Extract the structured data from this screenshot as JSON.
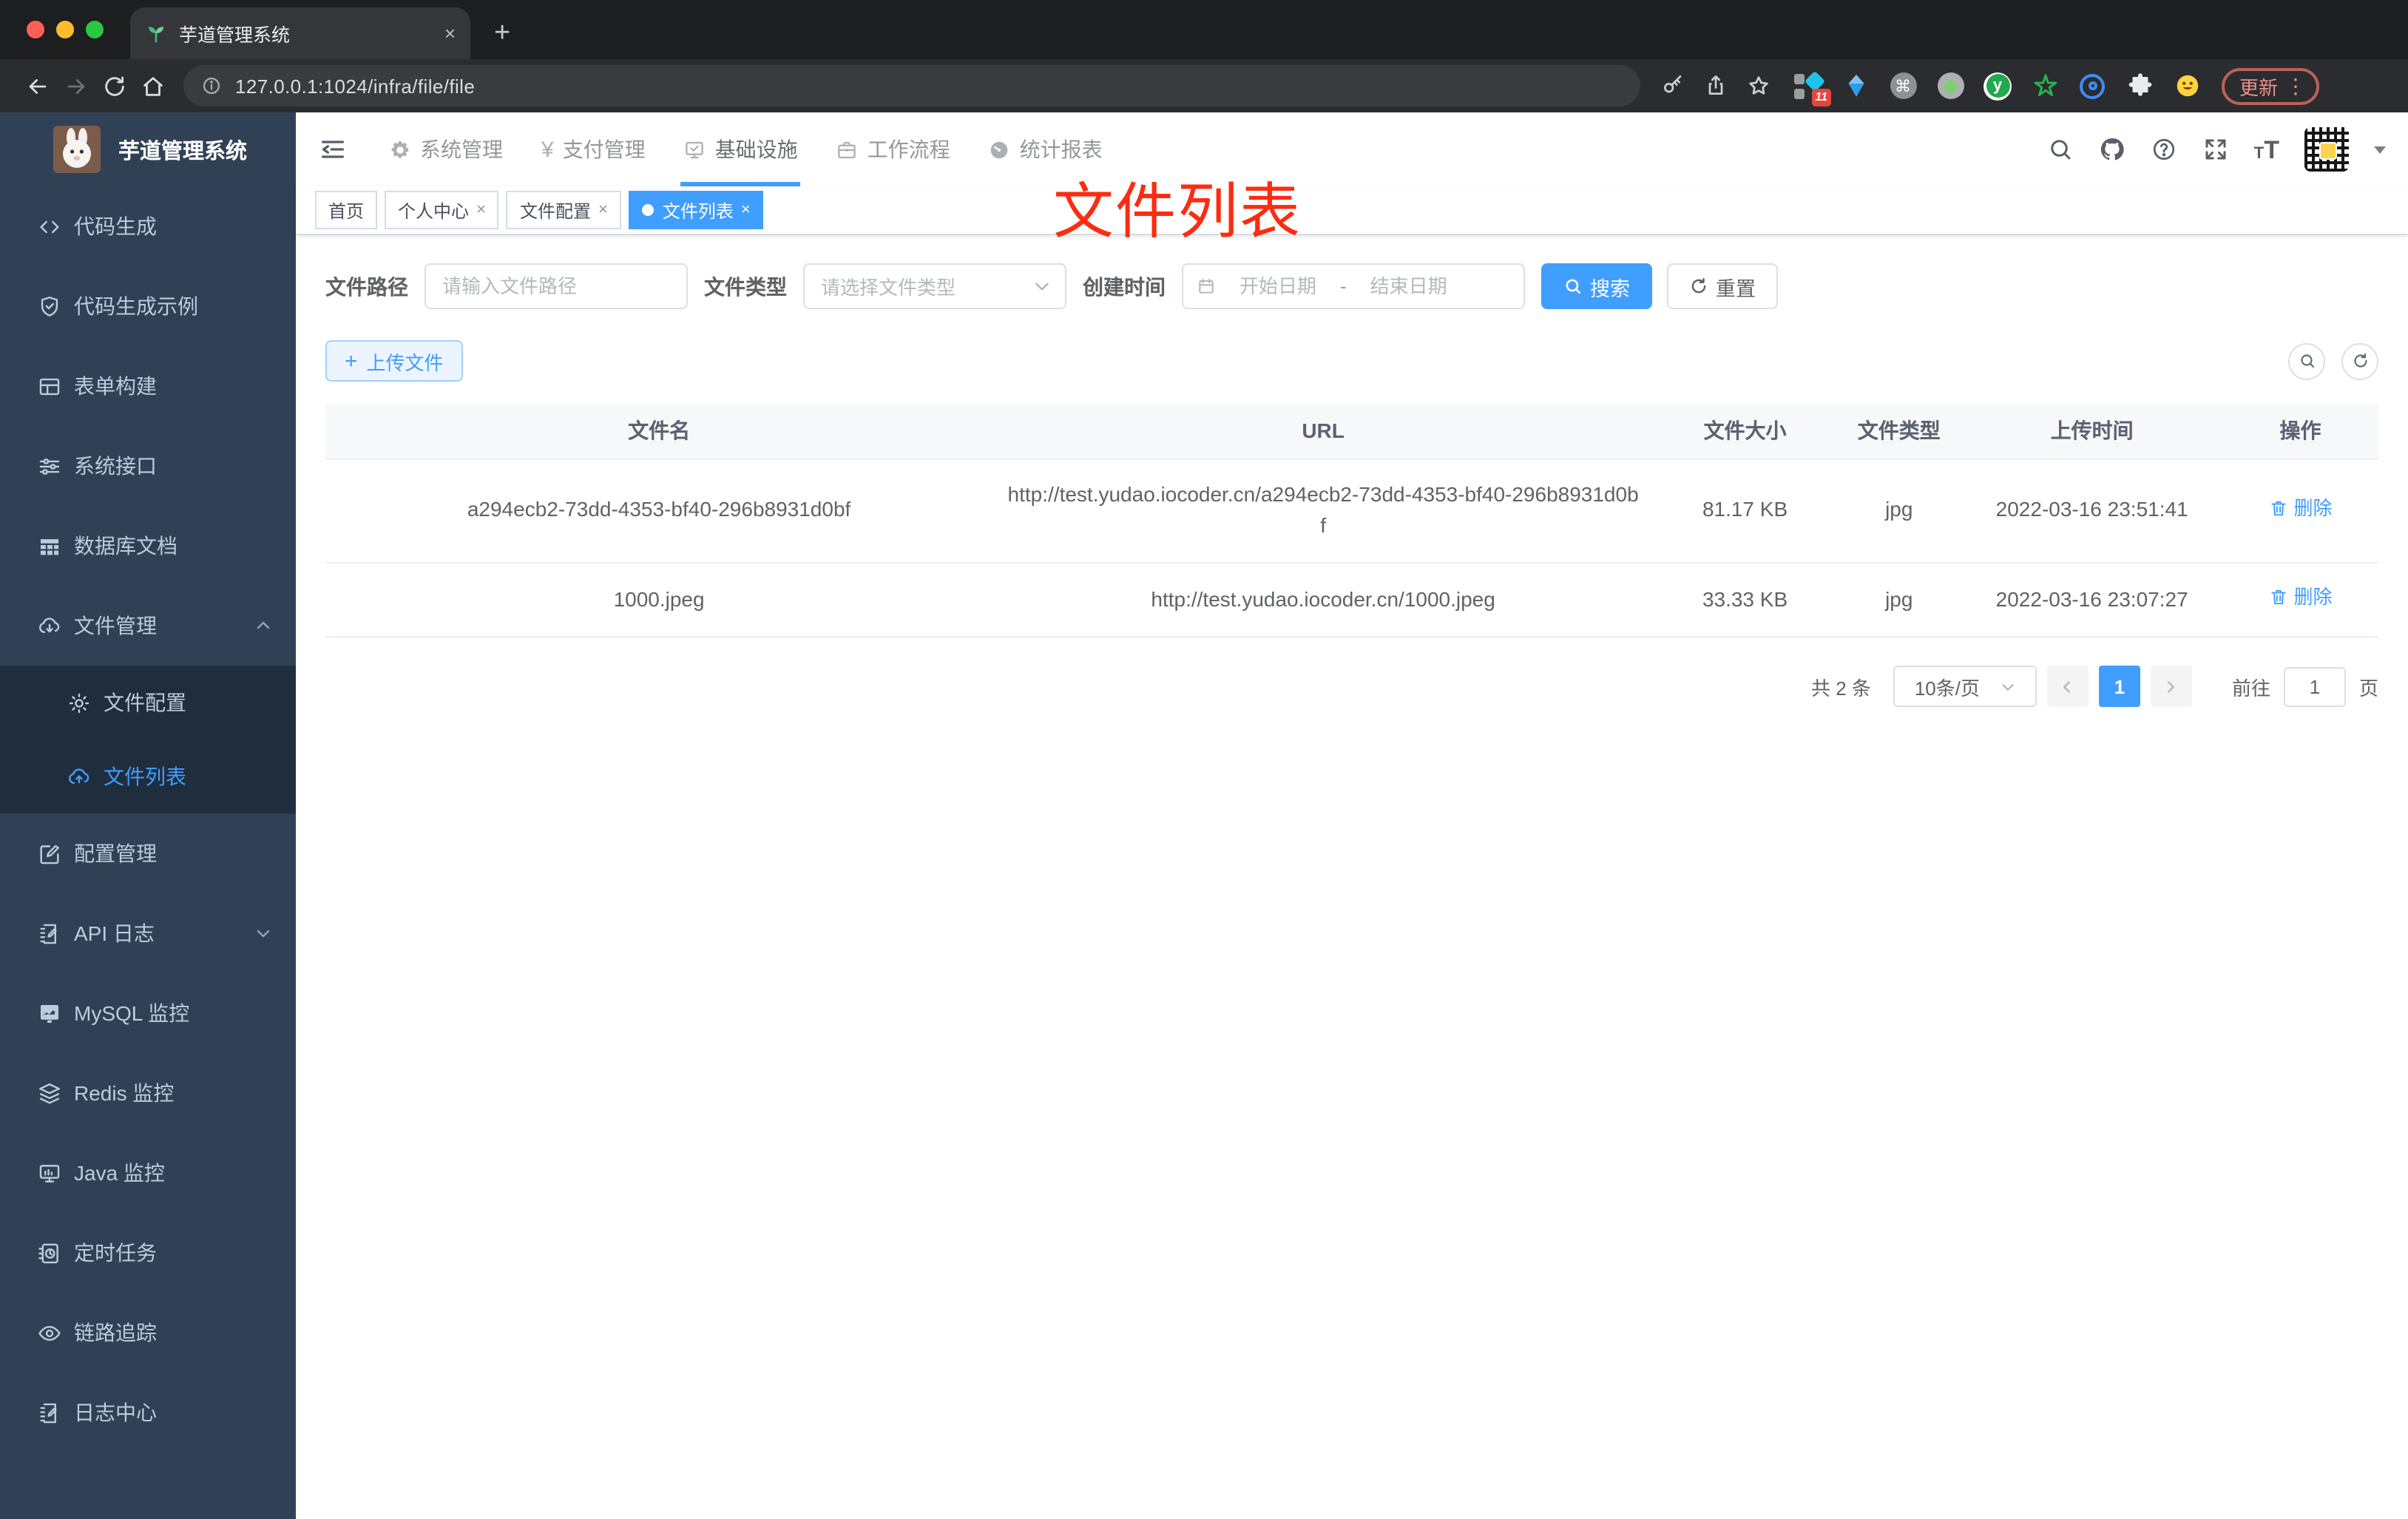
{
  "browser": {
    "tab_title": "芋道管理系统",
    "url": "127.0.0.1:1024/infra/file/file",
    "extension_badge": "11",
    "update_label": "更新"
  },
  "icons": {
    "close": "×",
    "plus": "+",
    "more": "⋮",
    "back": "←",
    "forward": "→",
    "command": "⌘",
    "letter_y": "y",
    "font_t_small": "T",
    "font_t_big": "T",
    "yen": "¥",
    "question": "?"
  },
  "sidebar": {
    "title": "芋道管理系统",
    "items": [
      {
        "label": "代码生成"
      },
      {
        "label": "代码生成示例"
      },
      {
        "label": "表单构建"
      },
      {
        "label": "系统接口"
      },
      {
        "label": "数据库文档"
      },
      {
        "label": "文件管理",
        "expanded": true,
        "children": [
          {
            "label": "文件配置"
          },
          {
            "label": "文件列表",
            "active": true
          }
        ]
      },
      {
        "label": "配置管理"
      },
      {
        "label": "API 日志",
        "collapsed": true
      },
      {
        "label": "MySQL 监控"
      },
      {
        "label": "Redis 监控"
      },
      {
        "label": "Java 监控"
      },
      {
        "label": "定时任务"
      },
      {
        "label": "链路追踪"
      },
      {
        "label": "日志中心"
      }
    ]
  },
  "topnav": {
    "items": [
      {
        "label": "系统管理"
      },
      {
        "label": "支付管理"
      },
      {
        "label": "基础设施",
        "active": true
      },
      {
        "label": "工作流程"
      },
      {
        "label": "统计报表"
      }
    ]
  },
  "tabs": {
    "items": [
      {
        "label": "首页"
      },
      {
        "label": "个人中心",
        "closable": true
      },
      {
        "label": "文件配置",
        "closable": true
      },
      {
        "label": "文件列表",
        "closable": true,
        "active": true
      }
    ]
  },
  "annotation": {
    "text": "文件列表",
    "color": "#fd2c10"
  },
  "filters": {
    "path_label": "文件路径",
    "path_placeholder": "请输入文件路径",
    "type_label": "文件类型",
    "type_placeholder": "请选择文件类型",
    "date_label": "创建时间",
    "date_start_placeholder": "开始日期",
    "date_separator": "-",
    "date_end_placeholder": "结束日期",
    "search_label": "搜索",
    "reset_label": "重置"
  },
  "toolbar": {
    "upload_label": "上传文件"
  },
  "table": {
    "headers": [
      "文件名",
      "URL",
      "文件大小",
      "文件类型",
      "上传时间",
      "操作"
    ],
    "rows": [
      {
        "name": "a294ecb2-73dd-4353-bf40-296b8931d0bf",
        "url": "http://test.yudao.iocoder.cn/a294ecb2-73dd-4353-bf40-296b8931d0bf",
        "size": "81.17 KB",
        "type": "jpg",
        "time": "2022-03-16 23:51:41",
        "action": "删除"
      },
      {
        "name": "1000.jpeg",
        "url": "http://test.yudao.iocoder.cn/1000.jpeg",
        "size": "33.33 KB",
        "type": "jpg",
        "time": "2022-03-16 23:07:27",
        "action": "删除"
      }
    ]
  },
  "pagination": {
    "total": "共 2 条",
    "page_size": "10条/页",
    "current_page": "1",
    "goto_label": "前往",
    "goto_value": "1",
    "page_unit": "页"
  },
  "colors": {
    "primary": "#409EFF",
    "sidebar_bg": "#304156",
    "submenu_bg": "#1f2d3d",
    "annotation": "#fd2c10"
  }
}
